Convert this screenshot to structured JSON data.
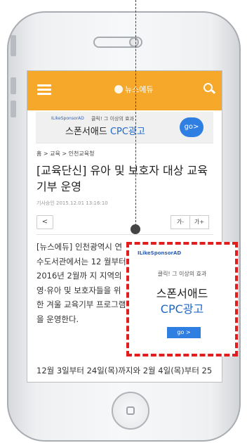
{
  "app": {
    "logo_text": "뉴스에듀"
  },
  "banner_ad": {
    "brand": "ILikeSponsorAD",
    "tagline": "클릭! 그 이상의 효과",
    "title_main": "스폰서애드 ",
    "title_cpc": "CPC광고",
    "go_label": "go>"
  },
  "article": {
    "breadcrumb": "홈 > 교육 > 인천교육청",
    "headline": "[교육단신] 유아 및 보호자 대상 교육 기부 운영",
    "meta": "기사승인 2015.12.01  13:16:10",
    "share_label": "<",
    "font_smaller": "가-",
    "font_larger": "가+",
    "body_wrapped": "[뉴스에듀] 인천광역시 연수도서관에서는 12 월부터 2016년 2월까 지 지역의 영·유아 및 보호자들을 위한 겨울 교육기부 프로그램을 운영한다.",
    "body_next": "12월 3일부터 24일(목)까지와 2월 4일(목)부터 25"
  },
  "inline_ad": {
    "brand": "ILikeSponsorAD",
    "tagline": "클릭! 그 이상의 효과",
    "line1": "스폰서애드",
    "line2": "CPC광고",
    "go_label": "go  >"
  },
  "colors": {
    "accent": "#f5a82a",
    "ad_outline": "#e11d1d",
    "link_blue": "#1f66c8",
    "button_blue": "#2f7fe3"
  }
}
